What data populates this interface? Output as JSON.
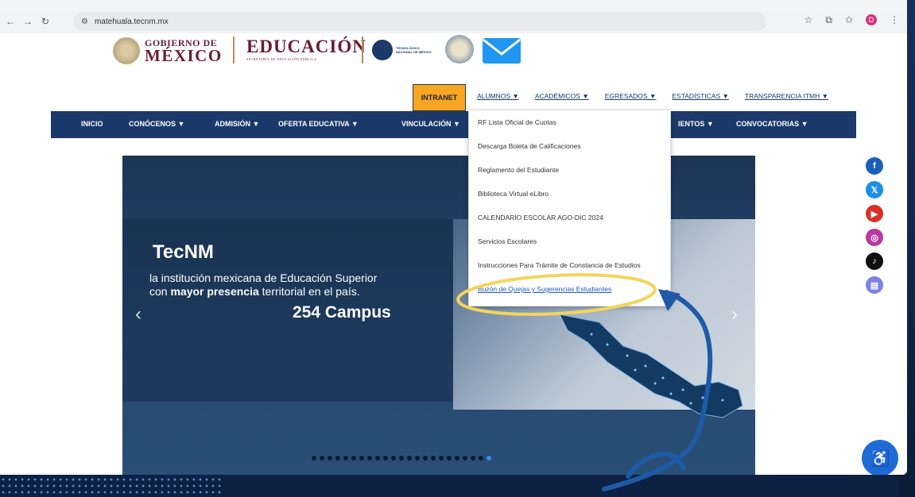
{
  "browser": {
    "url": "matehuala.tecnm.mx",
    "back_icon": "back-arrow-icon",
    "forward_icon": "forward-arrow-icon",
    "reload_icon": "reload-icon",
    "profile_initial": "D"
  },
  "header": {
    "gob_line1": "GOBIERNO DE",
    "gob_line2": "MÉXICO",
    "educ_title": "EDUCACIÓN",
    "educ_sub": "SECRETARÍA DE EDUCACIÓN PÚBLICA",
    "tecnm_text1": "TECNOLÓGICO",
    "tecnm_text2": "NACIONAL DE MÉXICO"
  },
  "top_menu": {
    "intranet": "INTRANET",
    "items": [
      "ALUMNOS ▼",
      "ACADÉMICOS ▼",
      "EGRESADOS ▼",
      "ESTADÍSTICAS ▼",
      "TRANSPARENCIA ITMH ▼"
    ]
  },
  "main_nav": {
    "items": [
      "INICIO",
      "CONÓCENOS ▼",
      "ADMISIÓN ▼",
      "OFERTA EDUCATIVA ▼",
      "VINCULACIÓN ▼",
      "IENTOS ▼",
      "CONVOCATORIAS ▼"
    ]
  },
  "dropdown": {
    "items": [
      "RF Lista Oficial de Cuotas",
      "Descarga Boleta de Calificaciones",
      "Reglamento del Estudiante",
      "Biblioteca Virtual eLibro",
      "CALENDARIO ESCOLAR AGO-DIC 2024",
      "Servicios Escolares",
      "Instrucciones Para Trámite de Constancia de Estudios",
      "Buzón de Quejas y Sugerencias Estudiantes"
    ]
  },
  "carousel": {
    "title": "TecNM",
    "line1": "la institución mexicana de Educación Superior",
    "line2_pre": "con ",
    "line2_bold": "mayor presencia",
    "line2_post": " territorial en el país.",
    "campus": "254 Campus",
    "prev": "‹",
    "next": "›",
    "dot_count": 23,
    "active_dot": 22
  },
  "social": {
    "icons": [
      "facebook-icon",
      "x-icon",
      "youtube-icon",
      "instagram-icon",
      "tiktok-icon",
      "document-icon"
    ],
    "glyphs": [
      "f",
      "𝕏",
      "▶",
      "◎",
      "♪",
      "▤"
    ],
    "colors": [
      "#1b5fb8",
      "#1e8fe8",
      "#d93025",
      "#b83aa0",
      "#111111",
      "#7b7fe6"
    ]
  },
  "colors": {
    "brand_navy": "#1b396a",
    "gob_maroon": "#691c32",
    "intranet_orange": "#f7a623",
    "highlight_yellow": "#f3d55b",
    "arrow_blue": "#1f5aa6"
  }
}
